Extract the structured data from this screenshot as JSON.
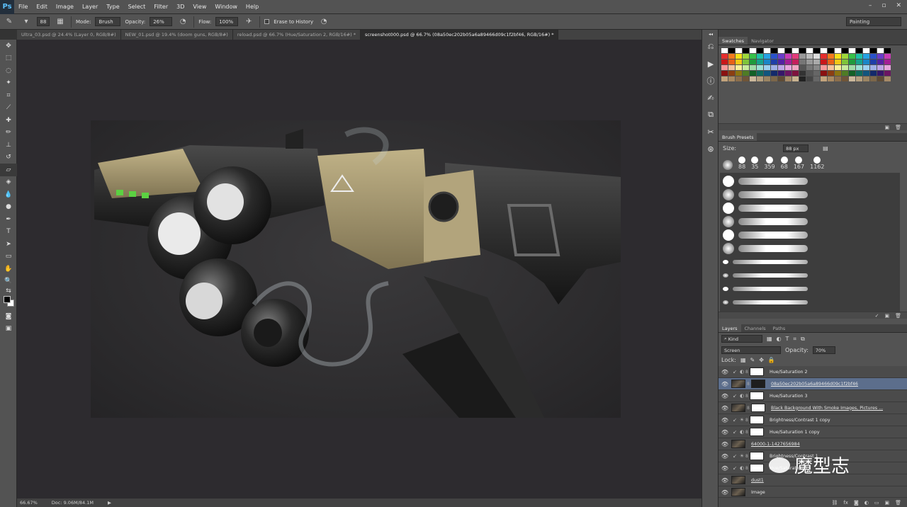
{
  "app": {
    "logo": "Ps",
    "menu": [
      "File",
      "Edit",
      "Image",
      "Layer",
      "Type",
      "Select",
      "Filter",
      "3D",
      "View",
      "Window",
      "Help"
    ]
  },
  "options": {
    "brush_size": "88",
    "mode_label": "Mode:",
    "mode_value": "Brush",
    "opacity_label": "Opacity:",
    "opacity_value": "26%",
    "flow_label": "Flow:",
    "flow_value": "100%",
    "erase_label": "Erase to History",
    "workspace": "Painting"
  },
  "tabs": [
    "Ultra_03.psd @ 24.4% (Layer 0, RGB/8#)",
    "NEW_01.psd @ 19.4% (doom guns, RGB/8#)",
    "reload.psd @ 66.7% (Hue/Saturation 2, RGB/16#) *",
    "screenshot000.psd @ 66.7% (08a50ec202b05a6a89466d09c1f2bf46, RGB/16#) *"
  ],
  "status": {
    "zoom": "66.67%",
    "doc": "Doc: 9.06M/84.1M"
  },
  "swatches": {
    "tabs": [
      "Swatches",
      "Navigator"
    ]
  },
  "brush_presets": {
    "title": "Brush Presets",
    "size_label": "Size:",
    "size_value": "88 px",
    "presets": [
      "88",
      "35",
      "359",
      "68",
      "167",
      "1162"
    ]
  },
  "layers": {
    "tabs": [
      "Layers",
      "Channels",
      "Paths"
    ],
    "kind": "Kind",
    "blend": "Screen",
    "opacity_label": "Opacity:",
    "opacity_value": "70%",
    "lock_label": "Lock:",
    "items": [
      "Hue/Saturation 2",
      "08a50ec202b05a6a89466d09c1f2bf46",
      "Hue/Saturation 3",
      "Black Background With Smoke Images, Pictures ...",
      "Brightness/Contrast 1 copy",
      "Hue/Saturation 1 copy",
      "64000-1-1427656984",
      "Brightness/Contrast 1",
      "Hue/Saturation 1",
      "dust1",
      "Image"
    ]
  },
  "watermark": "魔型志",
  "colors": {
    "ps_blue": "#5cc1ff",
    "gun_tan": "#a99a6e",
    "selection": "#5c6e8c"
  }
}
